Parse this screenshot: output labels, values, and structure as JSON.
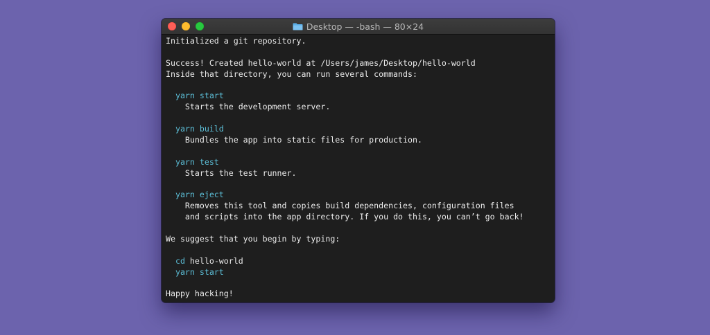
{
  "window": {
    "title": "Desktop — -bash — 80×24",
    "title_icon": "folder-icon"
  },
  "terminal": {
    "lines": [
      {
        "indent": "",
        "cmd": "",
        "text": "Initialized a git repository."
      },
      {
        "indent": "",
        "cmd": "",
        "text": ""
      },
      {
        "indent": "",
        "cmd": "",
        "text": "Success! Created hello-world at /Users/james/Desktop/hello-world"
      },
      {
        "indent": "",
        "cmd": "",
        "text": "Inside that directory, you can run several commands:"
      },
      {
        "indent": "",
        "cmd": "",
        "text": ""
      },
      {
        "indent": "  ",
        "cmd": "yarn start",
        "text": ""
      },
      {
        "indent": "    ",
        "cmd": "",
        "text": "Starts the development server."
      },
      {
        "indent": "",
        "cmd": "",
        "text": ""
      },
      {
        "indent": "  ",
        "cmd": "yarn build",
        "text": ""
      },
      {
        "indent": "    ",
        "cmd": "",
        "text": "Bundles the app into static files for production."
      },
      {
        "indent": "",
        "cmd": "",
        "text": ""
      },
      {
        "indent": "  ",
        "cmd": "yarn test",
        "text": ""
      },
      {
        "indent": "    ",
        "cmd": "",
        "text": "Starts the test runner."
      },
      {
        "indent": "",
        "cmd": "",
        "text": ""
      },
      {
        "indent": "  ",
        "cmd": "yarn eject",
        "text": ""
      },
      {
        "indent": "    ",
        "cmd": "",
        "text": "Removes this tool and copies build dependencies, configuration files"
      },
      {
        "indent": "    ",
        "cmd": "",
        "text": "and scripts into the app directory. If you do this, you can’t go back!"
      },
      {
        "indent": "",
        "cmd": "",
        "text": ""
      },
      {
        "indent": "",
        "cmd": "",
        "text": "We suggest that you begin by typing:"
      },
      {
        "indent": "",
        "cmd": "",
        "text": ""
      },
      {
        "indent": "  ",
        "cmd": "cd",
        "text": " hello-world"
      },
      {
        "indent": "  ",
        "cmd": "yarn start",
        "text": ""
      },
      {
        "indent": "",
        "cmd": "",
        "text": ""
      },
      {
        "indent": "",
        "cmd": "",
        "text": "Happy hacking!"
      }
    ]
  },
  "colors": {
    "background": "#6c63ad",
    "terminal_bg": "#1e1e1e",
    "text": "#ececec",
    "command": "#5dc0d9",
    "close": "#fe5f57",
    "minimize": "#febc2e",
    "zoom": "#28c840"
  }
}
